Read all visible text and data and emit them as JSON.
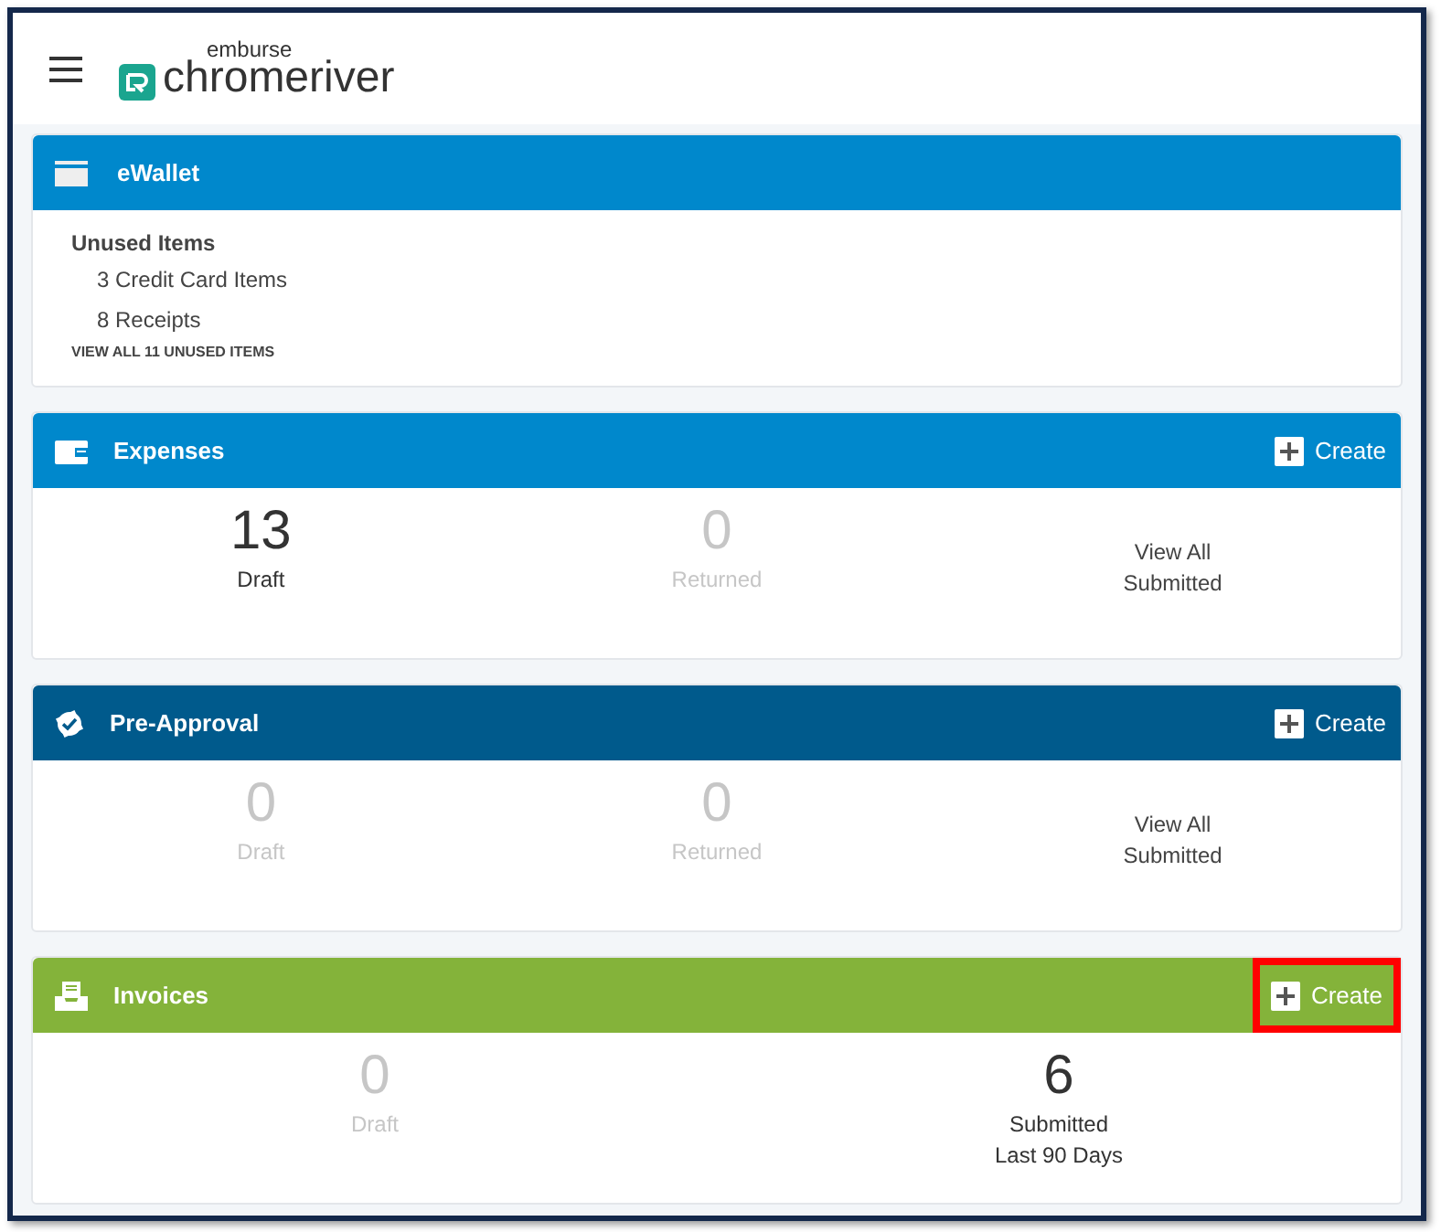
{
  "header": {
    "brand_top": "emburse",
    "brand_name": "chromeriver"
  },
  "wallet": {
    "title": "eWallet",
    "color": "#0088cc",
    "heading": "Unused Items",
    "items": [
      "3 Credit Card Items",
      "8 Receipts"
    ],
    "link": "VIEW ALL 11 UNUSED ITEMS"
  },
  "sections": [
    {
      "title": "Expenses",
      "kind": "wallet",
      "color": "#0088cc",
      "create": {
        "label": "Create",
        "highlighted": false
      },
      "stats": [
        {
          "kind": "count",
          "number": "13",
          "label": "Draft",
          "muted": false
        },
        {
          "kind": "count",
          "number": "0",
          "label": "Returned",
          "muted": true
        },
        {
          "kind": "link",
          "lines": [
            "View All",
            "Submitted"
          ]
        }
      ]
    },
    {
      "title": "Pre-Approval",
      "kind": "check",
      "color": "#005a8c",
      "create": {
        "label": "Create",
        "highlighted": false
      },
      "stats": [
        {
          "kind": "count",
          "number": "0",
          "label": "Draft",
          "muted": true
        },
        {
          "kind": "count",
          "number": "0",
          "label": "Returned",
          "muted": true
        },
        {
          "kind": "link",
          "lines": [
            "View All",
            "Submitted"
          ]
        }
      ]
    },
    {
      "title": "Invoices",
      "kind": "invoice",
      "color": "#84b33a",
      "create": {
        "label": "Create",
        "highlighted": true
      },
      "stats": [
        {
          "kind": "count",
          "number": "0",
          "label": "Draft",
          "muted": true
        },
        {
          "kind": "count",
          "number": "6",
          "label": "Submitted",
          "sub": "Last 90 Days",
          "muted": false
        }
      ]
    }
  ]
}
